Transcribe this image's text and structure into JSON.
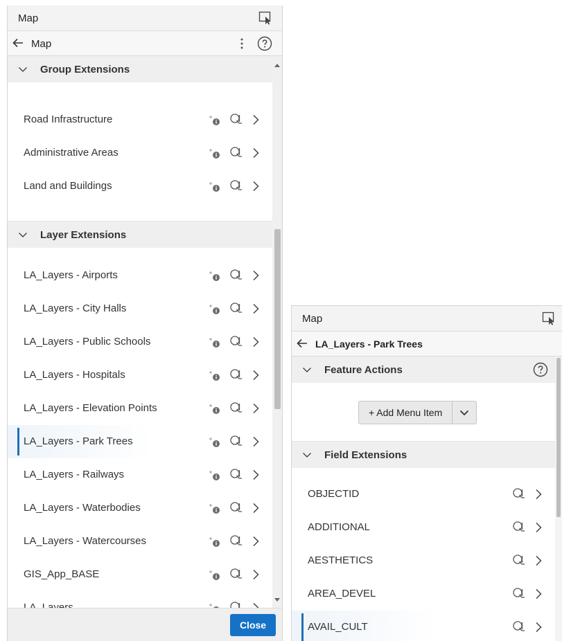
{
  "left_panel": {
    "title": "Map",
    "nav_title": "Map",
    "group_section": {
      "title": "Group Extensions",
      "items": [
        "Road Infrastructure",
        "Administrative Areas",
        "Land and Buildings"
      ]
    },
    "layer_section": {
      "title": "Layer Extensions",
      "items": [
        "LA_Layers - Airports",
        "LA_Layers - City Halls",
        "LA_Layers - Public Schools",
        "LA_Layers - Hospitals",
        "LA_Layers - Elevation Points",
        "LA_Layers - Park Trees",
        "LA_Layers - Railways",
        "LA_Layers - Waterbodies",
        "LA_Layers - Watercourses",
        "GIS_App_BASE",
        "LA_Layers"
      ],
      "selected": "LA_Layers - Park Trees"
    },
    "close_label": "Close"
  },
  "right_panel": {
    "title": "Map",
    "nav_title": "LA_Layers - Park Trees",
    "feature_section": {
      "title": "Feature Actions",
      "add_menu_label": "+ Add Menu Item"
    },
    "field_section": {
      "title": "Field Extensions",
      "items": [
        "OBJECTID",
        "ADDITIONAL",
        "AESTHETICS",
        "AREA_DEVEL",
        "AVAIL_CULT"
      ],
      "selected": "AVAIL_CULT"
    }
  },
  "icons": {
    "select": "select-tool-icon",
    "back": "back-arrow-icon",
    "more": "kebab-menu-icon",
    "help": "help-icon",
    "collapse": "chevron-down-icon",
    "info": "info-badge-icon",
    "query": "query-zoom-icon",
    "next": "chevron-right-icon"
  },
  "colors": {
    "accent": "#1572c6",
    "selection_bar": "#1f6fb5"
  }
}
